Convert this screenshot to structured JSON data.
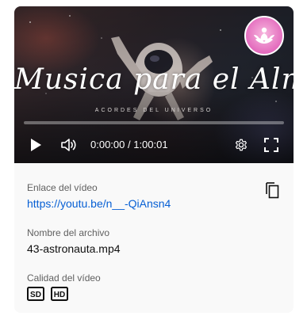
{
  "video": {
    "title_text": "Musica para el Alma",
    "subtitle_text": "ACORDES DEL UNIVERSO",
    "progress_fraction": 0,
    "time_display": "0:00:00 / 1:00:01",
    "colors": {
      "progress": "#ff0000",
      "logo": "#e36bbd"
    },
    "icons": [
      "play-icon",
      "volume-icon",
      "settings-icon",
      "fullscreen-icon",
      "lotus-logo-icon"
    ]
  },
  "share": {
    "link_label": "Enlace del vídeo",
    "link_url": "https://youtu.be/n__-QiAnsn4",
    "filename_label": "Nombre del archivo",
    "filename": "43-astronauta.mp4",
    "quality_label": "Calidad del vídeo",
    "quality_options": [
      "SD",
      "HD"
    ],
    "colors": {
      "link": "#065fd4"
    },
    "icons": [
      "copy-icon"
    ]
  }
}
